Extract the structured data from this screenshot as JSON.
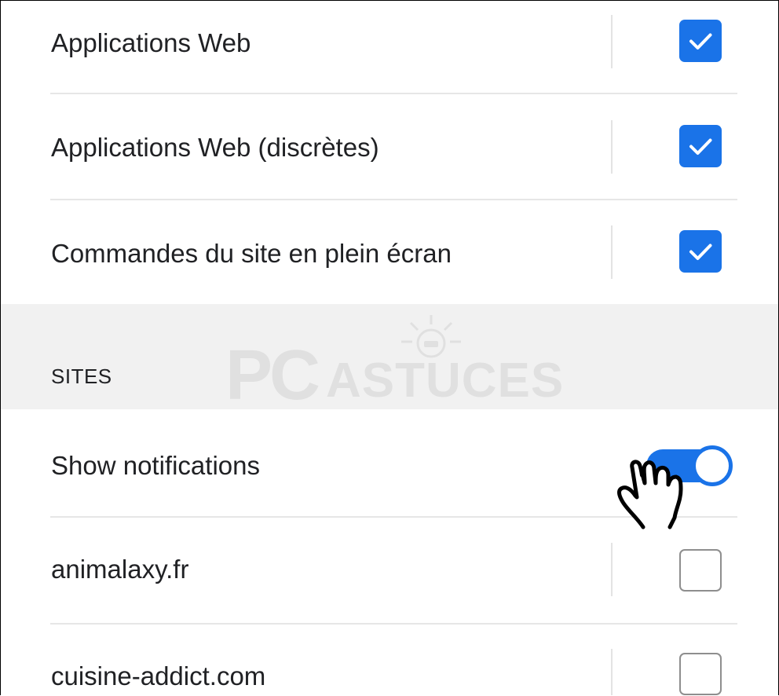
{
  "settings": {
    "items": [
      {
        "label": "Applications Web",
        "checked": true
      },
      {
        "label": "Applications Web (discrètes)",
        "checked": true
      },
      {
        "label": "Commandes du site en plein écran",
        "checked": true
      }
    ]
  },
  "sites_section": {
    "title": "SITES",
    "toggle": {
      "label": "Show notifications",
      "on": true
    },
    "sites": [
      {
        "label": "animalaxy.fr",
        "checked": false
      },
      {
        "label": "cuisine-addict.com",
        "checked": false
      }
    ]
  },
  "watermark": {
    "brand": "PC",
    "word": "ASTUCES"
  },
  "colors": {
    "accent": "#1a73e8",
    "text": "#202124",
    "section_band": "#f1f1f1",
    "separator": "#e6e6e6",
    "unchecked_border": "#8e8e8e"
  },
  "icons": {
    "checkbox_checked": "check-icon",
    "cursor": "hand-pointer-icon"
  }
}
